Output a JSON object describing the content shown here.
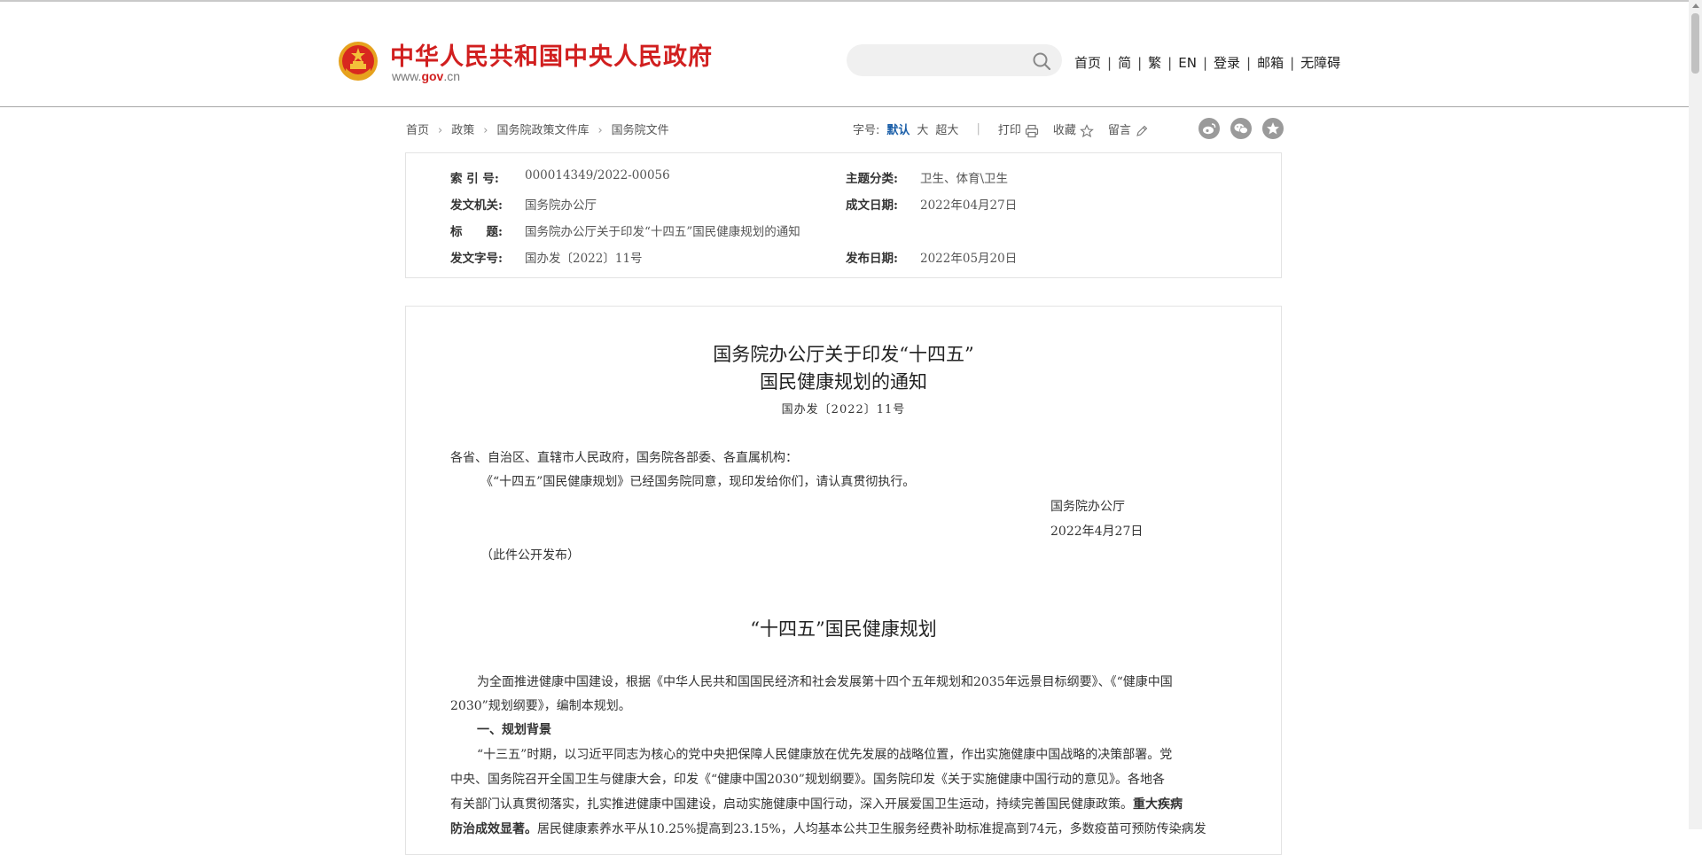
{
  "header": {
    "site_title": "中华人民共和国中央人民政府",
    "site_url_prefix": "www.",
    "site_url_brand": "gov",
    "site_url_suffix": ".cn",
    "search_placeholder": "",
    "nav": [
      "首页",
      "简",
      "繁",
      "EN",
      "登录",
      "邮箱",
      "无障碍"
    ]
  },
  "breadcrumb": [
    "首页",
    "政策",
    "国务院政策文件库",
    "国务院文件"
  ],
  "tools": {
    "font_size_label": "字号:",
    "font_default": "默认",
    "font_large": "大",
    "font_xlarge": "超大",
    "print": "打印",
    "favorite": "收藏",
    "comment": "留言"
  },
  "share_icons": [
    "weibo-icon",
    "wechat-icon",
    "favorite-star-icon"
  ],
  "meta": {
    "index_label": "索 引 号:",
    "index_value": "000014349/2022-00056",
    "topic_label": "主题分类:",
    "topic_value": "卫生、体育\\卫生",
    "issuer_label": "发文机关:",
    "issuer_value": "国务院办公厅",
    "date_written_label": "成文日期:",
    "date_written_value": "2022年04月27日",
    "title_label": "标　　题:",
    "title_value": "国务院办公厅关于印发“十四五”国民健康规划的通知",
    "doc_no_label": "发文字号:",
    "doc_no_value": "国办发〔2022〕11号",
    "publish_label": "发布日期:",
    "publish_value": "2022年05月20日"
  },
  "document": {
    "title_line1": "国务院办公厅关于印发“十四五”",
    "title_line2": "国民健康规划的通知",
    "doc_number": "国办发〔2022〕11号",
    "addressee": "各省、自治区、直辖市人民政府，国务院各部委、各直属机构：",
    "body": "《“十四五”国民健康规划》已经国务院同意，现印发给你们，请认真贯彻执行。",
    "signer": "国务院办公厅",
    "sign_date": "2022年4月27日",
    "public_note": "（此件公开发布）",
    "plan_title": "“十四五”国民健康规划",
    "intro_line1": "为全面推进健康中国建设，根据《中华人民共和国国民经济和社会发展第十四个五年规划和2035年远景目标纲要》、《“健康中国",
    "intro_line2": "2030”规划纲要》，编制本规划。",
    "section1": "一、规划背景",
    "para_line1": "“十三五”时期，以习近平同志为核心的党中央把保障人民健康放在优先发展的战略位置，作出实施健康中国战略的决策部署。党",
    "para_line2": "中央、国务院召开全国卫生与健康大会，印发《“健康中国2030”规划纲要》。国务院印发《关于实施健康中国行动的意见》。各地各",
    "para_line3_normal": "有关部门认真贯彻落实，扎实推进健康中国建设，启动实施健康中国行动，深入开展爱国卫生运动，持续完善国民健康政策。",
    "para_line3_bold": "重大疾病",
    "para_line4_bold": "防治成效显著。",
    "para_line4_normal": "居民健康素养水平从10.25%提高到23.15%，人均基本公共卫生服务经费补助标准提高到74元，多数疫苗可预防传染病发"
  }
}
